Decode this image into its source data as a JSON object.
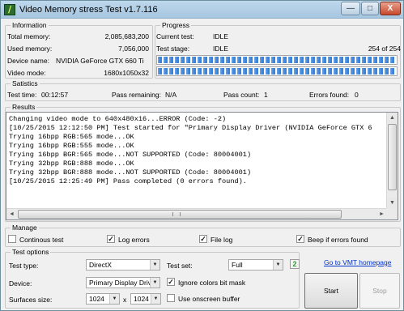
{
  "window": {
    "title": "Video Memory stress Test v1.7.116",
    "icon_glyph": "/",
    "min_glyph": "—",
    "max_glyph": "□",
    "close_glyph": "X"
  },
  "information": {
    "label": "Information",
    "total_memory": {
      "label": "Total memory:",
      "value": "2,085,683,200"
    },
    "used_memory": {
      "label": "Used memory:",
      "value": "7,056,000"
    },
    "device_name": {
      "label": "Device name:",
      "value": "NVIDIA GeForce GTX 660 Ti"
    },
    "video_mode": {
      "label": "Video mode:",
      "value": "1680x1050x32"
    }
  },
  "progress": {
    "label": "Progress",
    "current_test": {
      "label": "Current test:",
      "value": "IDLE"
    },
    "test_stage": {
      "label": "Test stage:",
      "value": "IDLE",
      "count": "254 of 254"
    },
    "bar1_fraction": 1.0,
    "bar2_fraction": 1.0
  },
  "statistics": {
    "label": "Satistics",
    "test_time": {
      "label": "Test time:",
      "value": "00:12:57"
    },
    "pass_remaining": {
      "label": "Pass remaining:",
      "value": "N/A"
    },
    "pass_count": {
      "label": "Pass count:",
      "value": "1"
    },
    "errors_found": {
      "label": "Errors found:",
      "value": "0"
    }
  },
  "results": {
    "label": "Results",
    "lines": [
      "Changing video mode to 640x480x16...ERROR (Code: -2)",
      "[10/25/2015 12:12:50 PM] Test started for \"Primary Display Driver (NVIDIA GeForce GTX 6",
      "Trying 16bpp RGB:565 mode...OK",
      "Trying 16bpp RGB:555 mode...OK",
      "Trying 16bpp BGR:565 mode...NOT SUPPORTED (Code: 80004001)",
      "Trying 32bpp RGB:888 mode...OK",
      "Trying 32bpp BGR:888 mode...NOT SUPPORTED (Code: 80004001)",
      "[10/25/2015 12:25:49 PM] Pass completed (0 errors found)."
    ],
    "up_glyph": "▲",
    "down_glyph": "▼",
    "left_glyph": "◄",
    "right_glyph": "►"
  },
  "manage": {
    "label": "Manage",
    "continuous_test": {
      "label": "Continous test",
      "checked": false
    },
    "log_errors": {
      "label": "Log errors",
      "checked": true
    },
    "file_log": {
      "label": "File log",
      "checked": true
    },
    "beep": {
      "label": "Beep if errors found",
      "checked": true
    },
    "check_glyph": "✓"
  },
  "test_options": {
    "label": "Test options",
    "test_type": {
      "label": "Test type:",
      "value": "DirectX"
    },
    "test_set": {
      "label": "Test set:",
      "value": "Full"
    },
    "device": {
      "label": "Device:",
      "value": "Primary Display Driver"
    },
    "ignore_colors": {
      "label": "Ignore colors bit mask",
      "checked": true
    },
    "surfaces_size": {
      "label": "Surfaces size:",
      "width": "1024",
      "x": "x",
      "height": "1024"
    },
    "onscreen_buffer": {
      "label": "Use onscreen buffer",
      "checked": false
    },
    "refresh_glyph": "2",
    "dropdown_glyph": "▼"
  },
  "links": {
    "vmt_homepage": "Go to VMT homepage"
  },
  "buttons": {
    "start": "Start",
    "stop": "Stop"
  }
}
